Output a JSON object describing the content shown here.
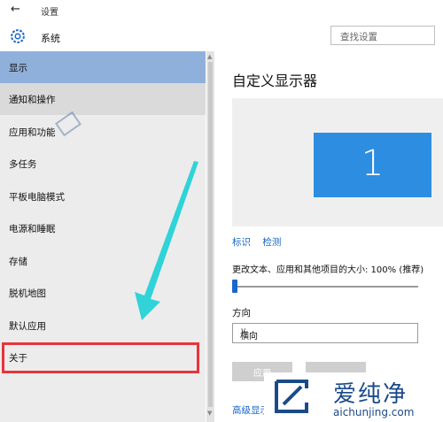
{
  "window": {
    "back_glyph": "←",
    "title": "设置"
  },
  "header": {
    "icon": "gear-icon",
    "section": "系统",
    "search_placeholder": "查找设置"
  },
  "sidebar": {
    "items": [
      {
        "label": "显示",
        "state": "selected"
      },
      {
        "label": "通知和操作",
        "state": "hover"
      },
      {
        "label": "应用和功能",
        "state": "normal"
      },
      {
        "label": "多任务",
        "state": "normal"
      },
      {
        "label": "平板电脑模式",
        "state": "normal"
      },
      {
        "label": "电源和睡眠",
        "state": "normal"
      },
      {
        "label": "存储",
        "state": "normal"
      },
      {
        "label": "脱机地图",
        "state": "normal"
      },
      {
        "label": "默认应用",
        "state": "normal"
      },
      {
        "label": "关于",
        "state": "annotated"
      }
    ]
  },
  "main": {
    "title": "自定义显示器",
    "monitor_number": "1",
    "links": [
      "标识",
      "检测"
    ],
    "scale_label": "更改文本、应用和其他项目的大小: 100% (推荐)",
    "scale_fraction": 0.0,
    "orientation_label": "方向",
    "orientation_value": "横向",
    "apply_button": "应用",
    "advanced_link": "高级显示"
  },
  "watermark": {
    "cn": "爱纯净",
    "en": "aichunjing.com"
  },
  "colors": {
    "selected": "#8fb0db",
    "accent": "#1a67c9",
    "monitor": "#2d8de0",
    "annotation": "#e8343a",
    "arrow": "#2fd3d8"
  }
}
